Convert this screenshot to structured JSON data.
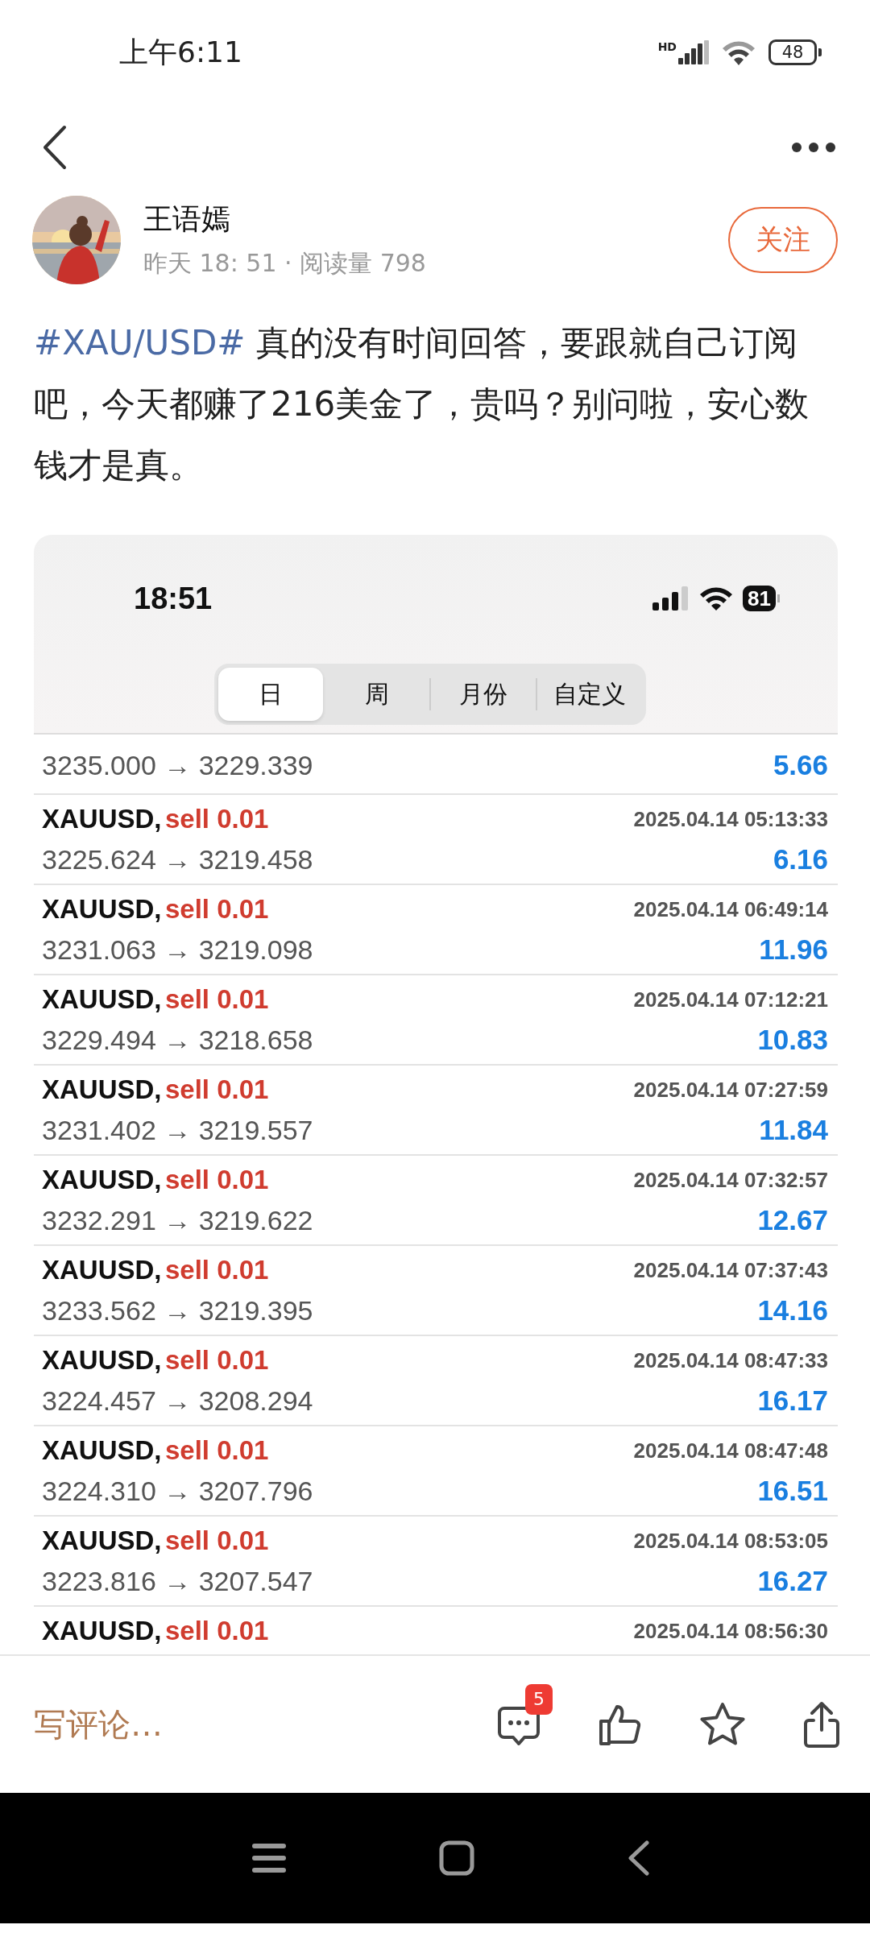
{
  "status_bar": {
    "time": "上午6:11",
    "network": "HD",
    "battery": "48"
  },
  "author": {
    "name": "王语嫣",
    "meta": "昨天 18: 51 · 阅读量 798",
    "follow_label": "关注"
  },
  "post": {
    "hashtag": "#XAU/USD#",
    "text": "真的没有时间回答，要跟就自己订阅吧，今天都赚了216美金了，贵吗？别问啦，安心数钱才是真。"
  },
  "screenshot": {
    "time": "18:51",
    "battery": "81",
    "tabs": [
      {
        "label": "日",
        "selected": true
      },
      {
        "label": "周",
        "selected": false
      },
      {
        "label": "月份",
        "selected": false
      },
      {
        "label": "自定义",
        "selected": false
      }
    ],
    "trades": [
      {
        "prices": "3235.000 → 3229.339",
        "profit": "5.66"
      },
      {
        "symbol": "XAUUSD,",
        "side": "sell 0.01",
        "time": "2025.04.14 05:13:33",
        "prices": "3225.624 → 3219.458",
        "profit": "6.16"
      },
      {
        "symbol": "XAUUSD,",
        "side": "sell 0.01",
        "time": "2025.04.14 06:49:14",
        "prices": "3231.063 → 3219.098",
        "profit": "11.96"
      },
      {
        "symbol": "XAUUSD,",
        "side": "sell 0.01",
        "time": "2025.04.14 07:12:21",
        "prices": "3229.494 → 3218.658",
        "profit": "10.83"
      },
      {
        "symbol": "XAUUSD,",
        "side": "sell 0.01",
        "time": "2025.04.14 07:27:59",
        "prices": "3231.402 → 3219.557",
        "profit": "11.84"
      },
      {
        "symbol": "XAUUSD,",
        "side": "sell 0.01",
        "time": "2025.04.14 07:32:57",
        "prices": "3232.291 → 3219.622",
        "profit": "12.67"
      },
      {
        "symbol": "XAUUSD,",
        "side": "sell 0.01",
        "time": "2025.04.14 07:37:43",
        "prices": "3233.562 → 3219.395",
        "profit": "14.16"
      },
      {
        "symbol": "XAUUSD,",
        "side": "sell 0.01",
        "time": "2025.04.14 08:47:33",
        "prices": "3224.457 → 3208.294",
        "profit": "16.17"
      },
      {
        "symbol": "XAUUSD,",
        "side": "sell 0.01",
        "time": "2025.04.14 08:47:48",
        "prices": "3224.310 → 3207.796",
        "profit": "16.51"
      },
      {
        "symbol": "XAUUSD,",
        "side": "sell 0.01",
        "time": "2025.04.14 08:53:05",
        "prices": "3223.816 → 3207.547",
        "profit": "16.27"
      },
      {
        "symbol": "XAUUSD,",
        "side": "sell 0.01",
        "time": "2025.04.14 08:56:30"
      }
    ]
  },
  "action_bar": {
    "comment_placeholder": "写评论…",
    "comment_count": "5"
  }
}
